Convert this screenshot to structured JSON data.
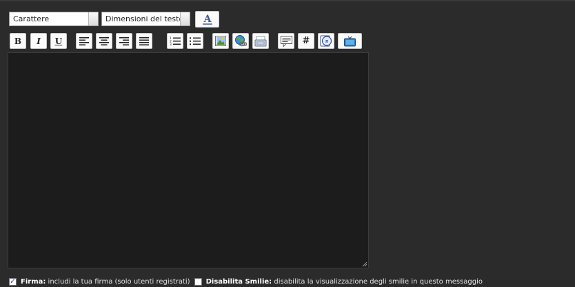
{
  "toolbar": {
    "font_select": "Carattere",
    "size_select": "Dimensioni del testo",
    "bold_label": "B",
    "italic_label": "I",
    "underline_label": "U",
    "hash_label": "#"
  },
  "icons": [
    "text-color-icon",
    "bold-icon",
    "italic-icon",
    "underline-icon",
    "align-left-icon",
    "align-center-icon",
    "align-right-icon",
    "justify-icon",
    "ordered-list-icon",
    "unordered-list-icon",
    "image-icon",
    "link-icon",
    "email-icon",
    "quote-icon",
    "code-icon",
    "flash-icon",
    "video-icon"
  ],
  "editor": {
    "value": ""
  },
  "options": {
    "signature": {
      "label": "Firma:",
      "desc": "includi la tua firma (solo utenti registrati)",
      "checked": true
    },
    "disable_smilies": {
      "label": "Disabilita Smilie:",
      "desc": "disabilita la visualizzazione degli smilie in questo messaggio",
      "checked": false
    }
  },
  "colors": {
    "background": "#2b2b2b",
    "editor_bg": "#1c1c1c",
    "button_bg": "#fafafa"
  }
}
